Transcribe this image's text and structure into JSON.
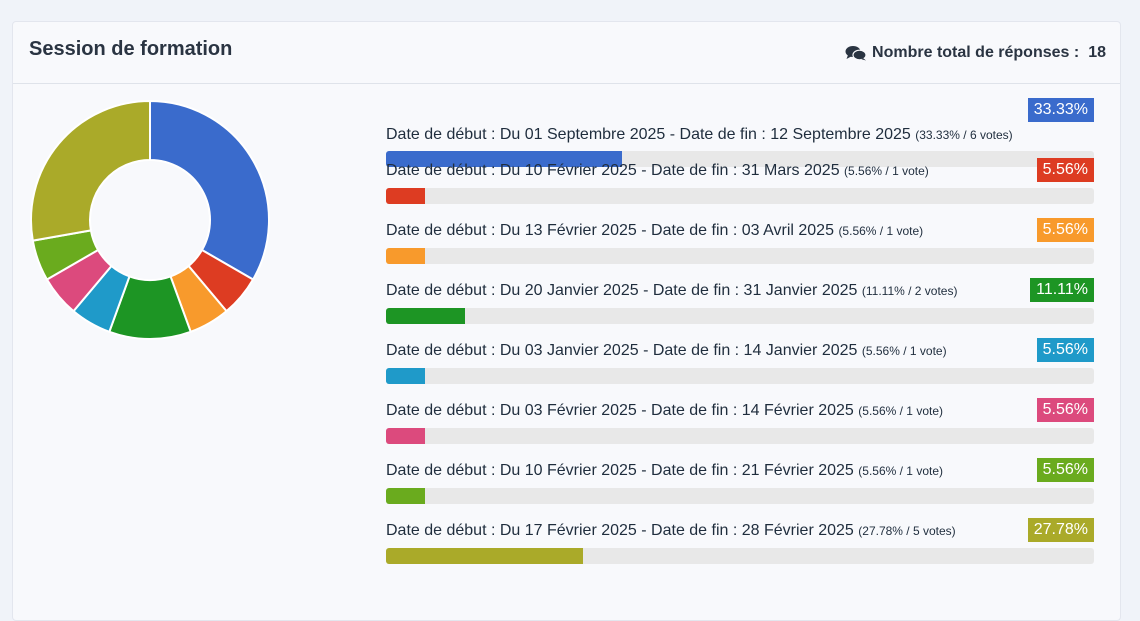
{
  "header": {
    "title": "Session de formation",
    "total_label": "Nombre total de réponses :",
    "total_count": "18",
    "icon": "comments-icon"
  },
  "options": [
    {
      "label": "Date de début : Du 01 Septembre 2025 - Date de fin : 12 Septembre 2025",
      "detail": "(33.33% / 6 votes)",
      "percent": "33.33%",
      "value": 33.33,
      "color": "#3a6bcc"
    },
    {
      "label": "Date de début : Du 10 Février 2025 - Date de fin : 31 Mars 2025",
      "detail": "(5.56% / 1 vote)",
      "percent": "5.56%",
      "value": 5.56,
      "color": "#dd3c22"
    },
    {
      "label": "Date de début : Du 13 Février 2025 - Date de fin : 03 Avril 2025",
      "detail": "(5.56% / 1 vote)",
      "percent": "5.56%",
      "value": 5.56,
      "color": "#f89a2c"
    },
    {
      "label": "Date de début : Du 20 Janvier 2025 - Date de fin : 31 Janvier 2025",
      "detail": "(11.11% / 2 votes)",
      "percent": "11.11%",
      "value": 11.11,
      "color": "#1d9524"
    },
    {
      "label": "Date de début : Du 03 Janvier 2025 - Date de fin : 14 Janvier 2025",
      "detail": "(5.56% / 1 vote)",
      "percent": "5.56%",
      "value": 5.56,
      "color": "#1f9ac9"
    },
    {
      "label": "Date de début : Du 03 Février 2025 - Date de fin : 14 Février 2025",
      "detail": "(5.56% / 1 vote)",
      "percent": "5.56%",
      "value": 5.56,
      "color": "#dc4a7d"
    },
    {
      "label": "Date de début : Du 10 Février 2025 - Date de fin : 21 Février 2025",
      "detail": "(5.56% / 1 vote)",
      "percent": "5.56%",
      "value": 5.56,
      "color": "#6aab1e"
    },
    {
      "label": "Date de début : Du 17 Février 2025 - Date de fin : 28 Février 2025",
      "detail": "(27.78% / 5 votes)",
      "percent": "27.78%",
      "value": 27.78,
      "color": "#aaaa29"
    }
  ],
  "chart_data": {
    "type": "pie",
    "style": "donut",
    "categories": [
      "Date de début : Du 01 Septembre 2025 - Date de fin : 12 Septembre 2025",
      "Date de début : Du 10 Février 2025 - Date de fin : 31 Mars 2025",
      "Date de début : Du 13 Février 2025 - Date de fin : 03 Avril 2025",
      "Date de début : Du 20 Janvier 2025 - Date de fin : 31 Janvier 2025",
      "Date de début : Du 03 Janvier 2025 - Date de fin : 14 Janvier 2025",
      "Date de début : Du 03 Février 2025 - Date de fin : 14 Février 2025",
      "Date de début : Du 10 Février 2025 - Date de fin : 21 Février 2025",
      "Date de début : Du 17 Février 2025 - Date de fin : 28 Février 2025"
    ],
    "values": [
      6,
      1,
      1,
      2,
      1,
      1,
      1,
      5
    ],
    "colors": [
      "#3a6bcc",
      "#dd3c22",
      "#f89a2c",
      "#1d9524",
      "#1f9ac9",
      "#dc4a7d",
      "#6aab1e",
      "#aaaa29"
    ]
  }
}
